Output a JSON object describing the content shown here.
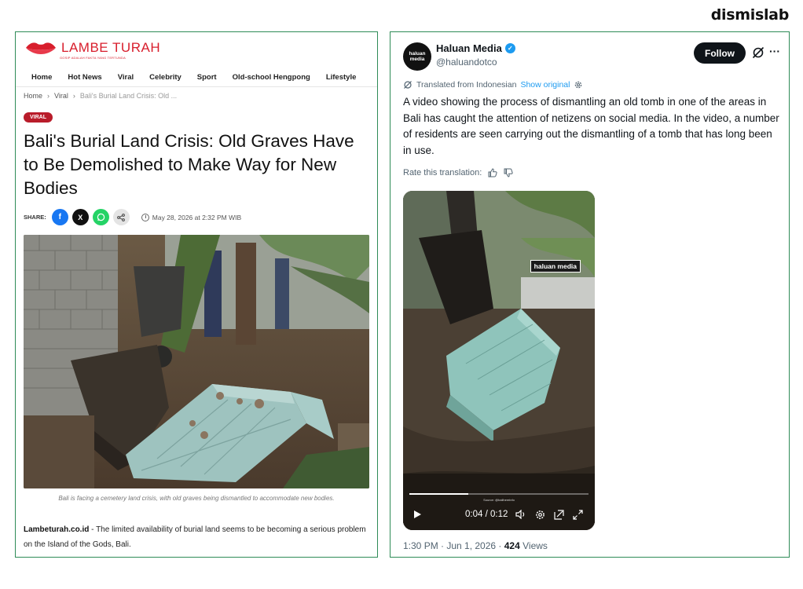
{
  "brand": "dismislab",
  "article": {
    "site_name": "LAMBE TURAH",
    "site_tagline": "GOSIP ADALAH FAKTA YANG TERTUNDA",
    "nav": [
      "Home",
      "Hot News",
      "Viral",
      "Celebrity",
      "Sport",
      "Old-school Hengpong",
      "Lifestyle"
    ],
    "breadcrumb": [
      "Home",
      "Viral",
      "Bali's Burial Land Crisis: Old ..."
    ],
    "badge": "VIRAL",
    "headline": "Bali's Burial Land Crisis: Old Graves Have to Be Demolished to Make Way for New Bodies",
    "share_label": "SHARE:",
    "share_buttons": [
      "f",
      "X",
      "whatsapp",
      "share"
    ],
    "date": "May 28, 2026 at 2:32 PM WIB",
    "caption": "Bali is facing a cemetery land crisis, with old graves being dismantled to accommodate new bodies.",
    "body_source": "Lambeturah.co.id",
    "body_text": " - The limited availability of burial land seems to be becoming a serious problem on the Island of the Gods, Bali."
  },
  "tweet": {
    "display_name": "Haluan Media",
    "handle": "@haluandotco",
    "avatar_text": "haluan media",
    "follow_label": "Follow",
    "translated_from": "Translated from Indonesian",
    "show_original": "Show original",
    "text": "A video showing the process of dismantling an old tomb in one of the areas in Bali has caught the attention of netizens on social media. In the video, a number of residents are seen carrying out the dismantling of a tomb that has long been in use.",
    "rate_label": "Rate this translation:",
    "video": {
      "watermark": "haluan media",
      "source_text": "Source: @balihereinfo",
      "current_time": "0:04",
      "separator": "/",
      "duration": "0:12",
      "progress": 0.33
    },
    "time": "1:30 PM · Jun 1, 2026 · ",
    "views_count": "424",
    "views_label": " Views"
  },
  "colors": {
    "panel_border": "#2e8b57",
    "lambe_red": "#d81e2c",
    "badge_red": "#b91c2a",
    "twitter_blue": "#1d9bf0",
    "facebook": "#1877f2",
    "whatsapp": "#25d366"
  }
}
